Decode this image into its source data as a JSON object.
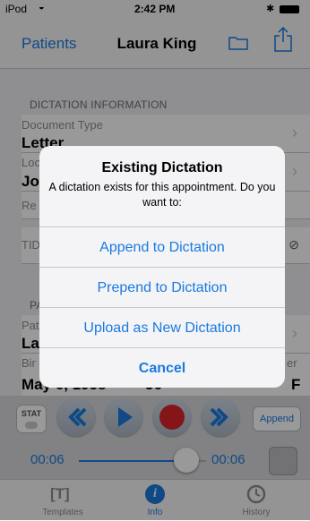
{
  "status_bar": {
    "carrier": "iPod",
    "time": "2:42 PM"
  },
  "nav": {
    "back_label": "Patients",
    "title": "Laura King"
  },
  "dictation_info": {
    "section_title": "DICTATION INFORMATION",
    "document_type_label": "Document Type",
    "document_type_value": "Letter",
    "location_label": "Loc",
    "location_value": "Jo",
    "referring_label": "Re",
    "tid_label": "TID"
  },
  "patient_info": {
    "section_title": "PA",
    "patient_label": "Pat",
    "patient_value": "La",
    "birth_label": "Bir",
    "birth_value": "May 6, 1958",
    "age_value": "56",
    "gender_label": "er",
    "gender_value": "F"
  },
  "alert": {
    "title": "Existing Dictation",
    "message": "A dictation exists for this appointment. Do you want to:",
    "buttons": [
      "Append to Dictation",
      "Prepend to Dictation",
      "Upload as New Dictation",
      "Cancel"
    ]
  },
  "transport": {
    "stat_label": "STAT",
    "append_label": "Append"
  },
  "scrubber": {
    "elapsed": "00:06",
    "total": "00:06"
  },
  "tabs": [
    {
      "label": "Templates",
      "icon": "templates-icon",
      "glyph": "[T]"
    },
    {
      "label": "Info",
      "icon": "info-icon",
      "glyph": "i"
    },
    {
      "label": "History",
      "icon": "history-icon",
      "glyph": ""
    }
  ],
  "colors": {
    "accent": "#1a7ae0",
    "record": "#e0242b",
    "background": "#efeff4"
  }
}
